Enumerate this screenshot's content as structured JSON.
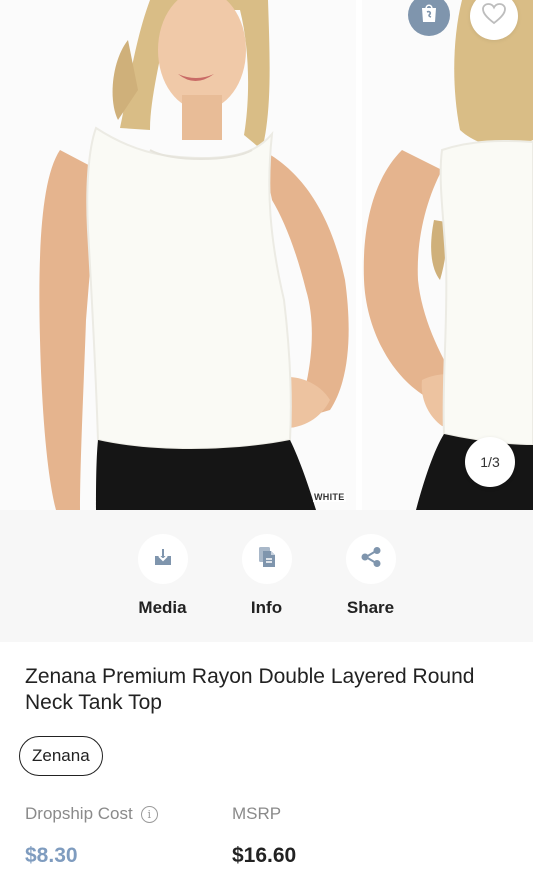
{
  "gallery": {
    "color_tag": "WHITE",
    "counter": "1/3",
    "shop_icon": "shopify-bag-icon",
    "wishlist_icon": "heart-icon"
  },
  "actions": [
    {
      "label": "Media",
      "icon": "download-icon"
    },
    {
      "label": "Info",
      "icon": "document-icon"
    },
    {
      "label": "Share",
      "icon": "share-icon"
    }
  ],
  "product": {
    "title": "Zenana Premium Rayon Double Layered Round Neck Tank Top",
    "brand": "Zenana"
  },
  "pricing": {
    "dropship_label": "Dropship Cost",
    "dropship_value": "$8.30",
    "msrp_label": "MSRP",
    "msrp_value": "$16.60"
  },
  "colors": {
    "accent": "#7f9cbf",
    "shop_badge": "#7f95ad",
    "action_bg": "#f7f7f7"
  }
}
